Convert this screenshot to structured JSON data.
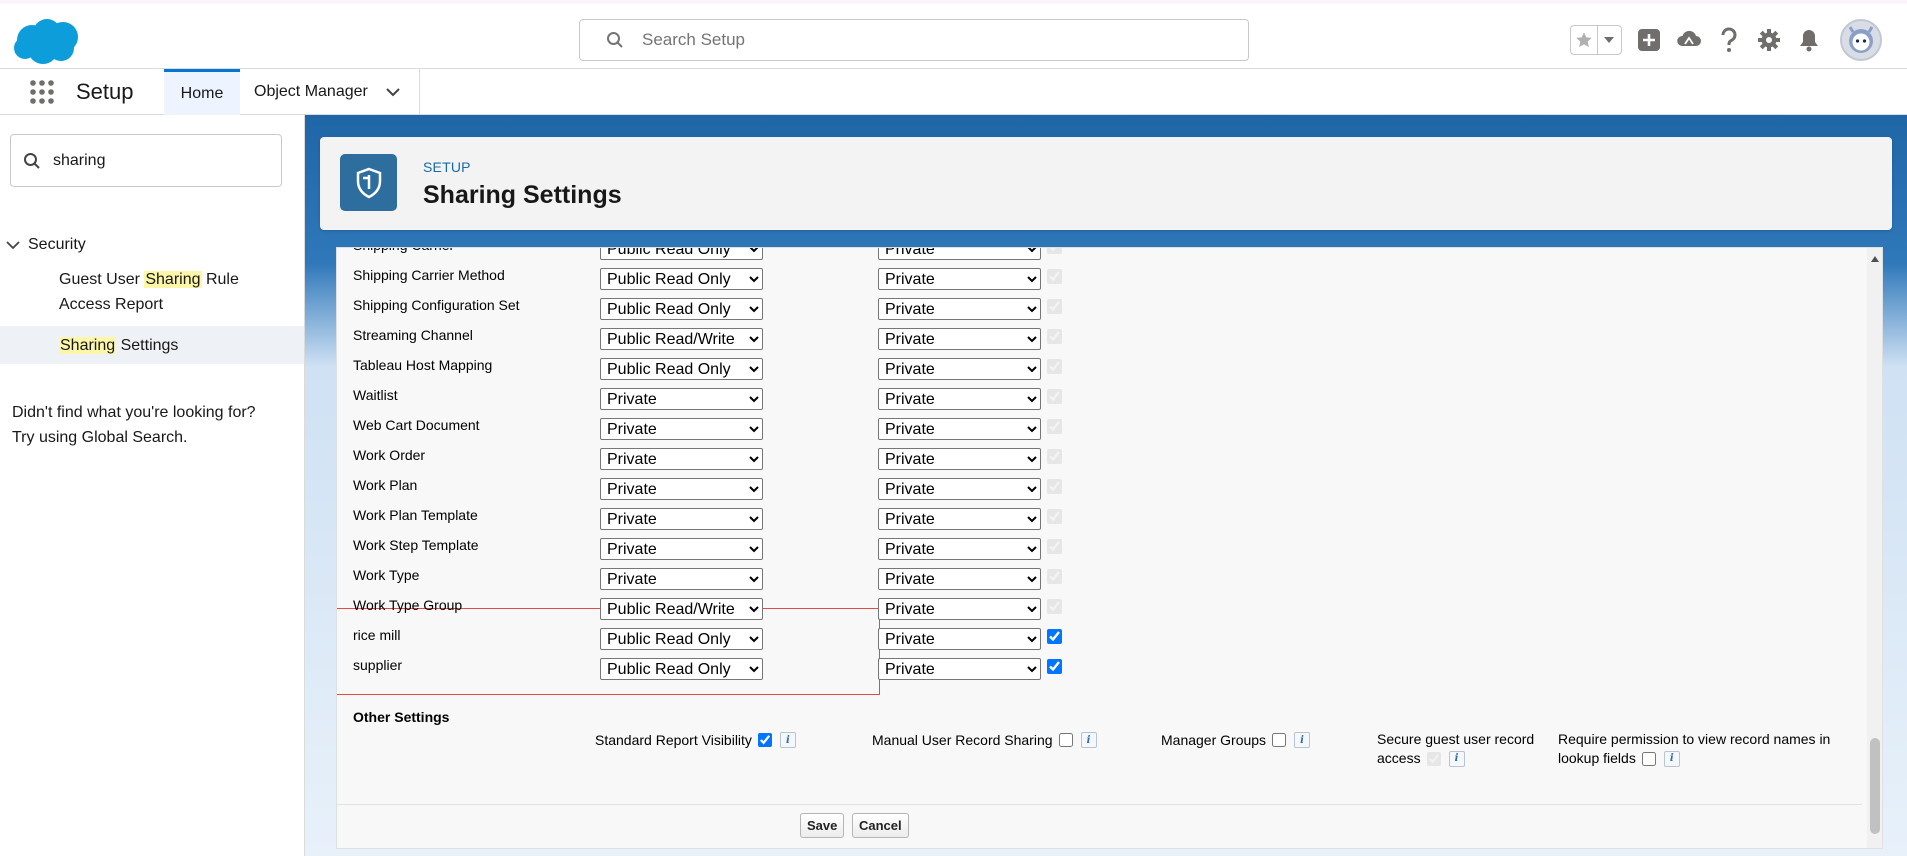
{
  "header": {
    "search_placeholder": "Search Setup"
  },
  "navbar": {
    "app_name": "Setup",
    "tabs": [
      {
        "label": "Home",
        "active": true
      },
      {
        "label": "Object Manager",
        "active": false
      }
    ]
  },
  "sidebar": {
    "quick_find_value": "sharing",
    "section": "Security",
    "items": [
      {
        "pre": "Guest User ",
        "hl": "Sharing",
        "post": " Rule Access Report"
      },
      {
        "pre": "",
        "hl": "Sharing",
        "post": " Settings"
      }
    ],
    "not_found_line1": "Didn't find what you're looking for?",
    "not_found_line2": "Try using Global Search."
  },
  "page": {
    "setup_label": "SETUP",
    "title": "Sharing Settings"
  },
  "sharing_rows": [
    {
      "object": "Shipping Carrier",
      "default": "Public Read Only",
      "external": "Private",
      "hierarchy": true,
      "editable": false
    },
    {
      "object": "Shipping Carrier Method",
      "default": "Public Read Only",
      "external": "Private",
      "hierarchy": true,
      "editable": false
    },
    {
      "object": "Shipping Configuration Set",
      "default": "Public Read Only",
      "external": "Private",
      "hierarchy": true,
      "editable": false
    },
    {
      "object": "Streaming Channel",
      "default": "Public Read/Write",
      "external": "Private",
      "hierarchy": true,
      "editable": false
    },
    {
      "object": "Tableau Host Mapping",
      "default": "Public Read Only",
      "external": "Private",
      "hierarchy": true,
      "editable": false
    },
    {
      "object": "Waitlist",
      "default": "Private",
      "external": "Private",
      "hierarchy": true,
      "editable": false
    },
    {
      "object": "Web Cart Document",
      "default": "Private",
      "external": "Private",
      "hierarchy": true,
      "editable": false
    },
    {
      "object": "Work Order",
      "default": "Private",
      "external": "Private",
      "hierarchy": true,
      "editable": false
    },
    {
      "object": "Work Plan",
      "default": "Private",
      "external": "Private",
      "hierarchy": true,
      "editable": false
    },
    {
      "object": "Work Plan Template",
      "default": "Private",
      "external": "Private",
      "hierarchy": true,
      "editable": false
    },
    {
      "object": "Work Step Template",
      "default": "Private",
      "external": "Private",
      "hierarchy": true,
      "editable": false
    },
    {
      "object": "Work Type",
      "default": "Private",
      "external": "Private",
      "hierarchy": true,
      "editable": false
    },
    {
      "object": "Work Type Group",
      "default": "Public Read/Write",
      "external": "Private",
      "hierarchy": true,
      "editable": false
    },
    {
      "object": "rice mill",
      "default": "Public Read Only",
      "external": "Private",
      "hierarchy": true,
      "editable": true
    },
    {
      "object": "supplier",
      "default": "Public Read Only",
      "external": "Private",
      "hierarchy": true,
      "editable": true
    }
  ],
  "access_options": [
    "Private",
    "Public Read Only",
    "Public Read/Write"
  ],
  "other_settings": {
    "title": "Other Settings",
    "standard_report_visibility": {
      "label": "Standard Report Visibility",
      "checked": true
    },
    "manual_user_record_sharing": {
      "label": "Manual User Record Sharing",
      "checked": false
    },
    "manager_groups": {
      "label": "Manager Groups",
      "checked": false
    },
    "secure_guest_access": {
      "label_line1": "Secure guest user record",
      "label_line2": "access",
      "checked": true
    },
    "require_permission": {
      "label_line1": "Require permission to view record names in",
      "label_line2": "lookup fields",
      "checked": false
    }
  },
  "buttons": {
    "save": "Save",
    "cancel": "Cancel"
  },
  "colors": {
    "brand": "#0176d3",
    "header_badge": "#2e6e9e",
    "highlight_box": "#e24a4a",
    "search_highlight": "#fbf6a8"
  }
}
